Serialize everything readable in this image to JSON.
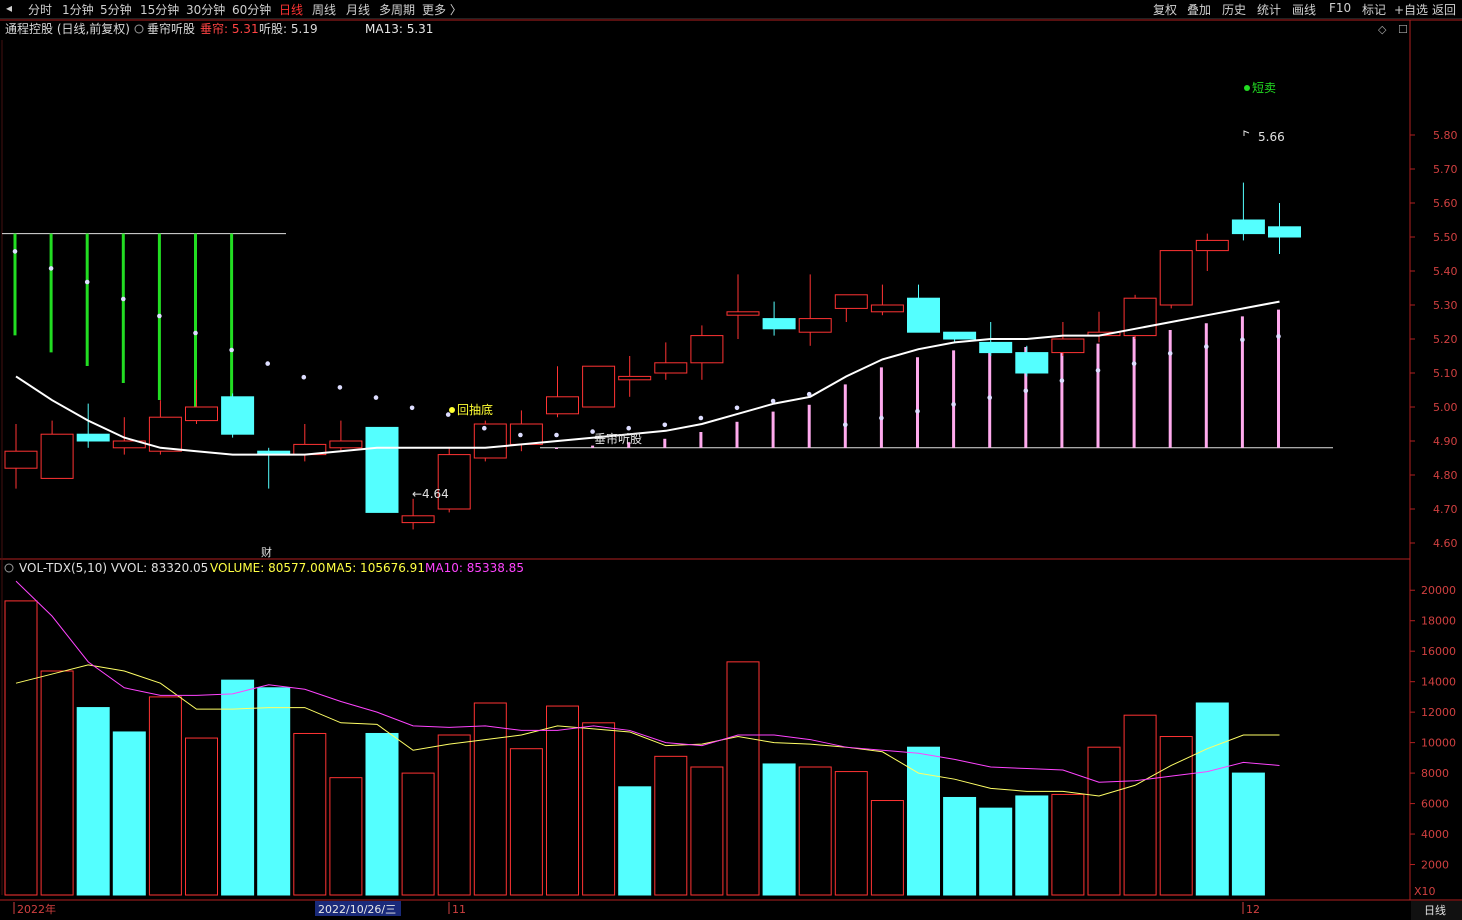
{
  "toolbar": {
    "left_items": [
      "分时",
      "1分钟",
      "5分钟",
      "15分钟",
      "30分钟",
      "60分钟",
      "日线",
      "周线",
      "月线",
      "多周期",
      "更多 〉"
    ],
    "active_index": 6,
    "right_items": [
      "复权",
      "叠加",
      "历史",
      "统计",
      "画线",
      "F10",
      "标记",
      "+自选",
      "返回"
    ]
  },
  "price_header": {
    "stock": "通程控股 (日线,前复权)",
    "indicator": "垂帘听股",
    "indicator_label": "垂帘:",
    "indicator_value": "5.31",
    "listen_label": "听股:",
    "listen_value": "5.19",
    "ma_label": "MA13:",
    "ma_value": "5.31"
  },
  "vol_header": {
    "name": "VOL-TDX(5,10)",
    "vvol_label": "VVOL:",
    "vvol_value": "83320.05",
    "volume_label": "VOLUME:",
    "volume_value": "80577.00",
    "ma5_label": "MA5:",
    "ma5_value": "105676.91",
    "ma10_label": "MA10:",
    "ma10_value": "85338.85"
  },
  "annotations": {
    "low_label": "←4.64",
    "high_label": "5.66",
    "short_sell": "短卖",
    "buy_label": "回抽底",
    "indicator_text": "垂帘听股",
    "finance_marker": "财",
    "vol_scale": "X10"
  },
  "xaxis": {
    "year_label": "2022年",
    "cursor_date": "2022/10/26/三",
    "month_nov": "11",
    "month_dec": "12",
    "period": "日线"
  },
  "colors": {
    "up": "#ff3333",
    "down": "#54ffff",
    "ma_price": "#ffffff",
    "ma5_vol": "#ffff66",
    "ma10_vol": "#ff44ff",
    "axis": "#b02020",
    "green_bar": "#22dd22",
    "pink_bar": "#ffaaee"
  },
  "chart_data": [
    {
      "type": "candlestick",
      "ylim": [
        4.5,
        5.88
      ],
      "yticks": [
        4.6,
        4.7,
        4.8,
        4.9,
        5.0,
        5.1,
        5.2,
        5.3,
        5.4,
        5.5,
        5.6,
        5.7,
        5.8
      ],
      "candles": [
        {
          "o": 4.82,
          "c": 4.87,
          "h": 4.95,
          "l": 4.76
        },
        {
          "o": 4.79,
          "c": 4.92,
          "h": 4.96,
          "l": 4.79
        },
        {
          "o": 4.92,
          "c": 4.9,
          "h": 5.01,
          "l": 4.88
        },
        {
          "o": 4.88,
          "c": 4.9,
          "h": 4.97,
          "l": 4.86
        },
        {
          "o": 4.87,
          "c": 4.97,
          "h": 5.02,
          "l": 4.86
        },
        {
          "o": 4.96,
          "c": 5.0,
          "h": 5.08,
          "l": 4.95
        },
        {
          "o": 5.03,
          "c": 4.92,
          "h": 5.04,
          "l": 4.91
        },
        {
          "o": 4.87,
          "c": 4.86,
          "h": 4.88,
          "l": 4.76
        },
        {
          "o": 4.86,
          "c": 4.89,
          "h": 4.95,
          "l": 4.84
        },
        {
          "o": 4.88,
          "c": 4.9,
          "h": 4.96,
          "l": 4.87
        },
        {
          "o": 4.94,
          "c": 4.69,
          "h": 4.94,
          "l": 4.69
        },
        {
          "o": 4.66,
          "c": 4.68,
          "h": 4.73,
          "l": 4.64
        },
        {
          "o": 4.7,
          "c": 4.86,
          "h": 4.88,
          "l": 4.69
        },
        {
          "o": 4.85,
          "c": 4.95,
          "h": 4.96,
          "l": 4.84
        },
        {
          "o": 4.89,
          "c": 4.95,
          "h": 4.99,
          "l": 4.87
        },
        {
          "o": 4.98,
          "c": 5.03,
          "h": 5.12,
          "l": 4.97
        },
        {
          "o": 5.0,
          "c": 5.12,
          "h": 5.12,
          "l": 5.0
        },
        {
          "o": 5.08,
          "c": 5.09,
          "h": 5.15,
          "l": 5.03
        },
        {
          "o": 5.1,
          "c": 5.13,
          "h": 5.19,
          "l": 5.08
        },
        {
          "o": 5.13,
          "c": 5.21,
          "h": 5.24,
          "l": 5.08
        },
        {
          "o": 5.27,
          "c": 5.28,
          "h": 5.39,
          "l": 5.2
        },
        {
          "o": 5.26,
          "c": 5.23,
          "h": 5.31,
          "l": 5.21
        },
        {
          "o": 5.22,
          "c": 5.26,
          "h": 5.39,
          "l": 5.18
        },
        {
          "o": 5.29,
          "c": 5.33,
          "h": 5.33,
          "l": 5.25
        },
        {
          "o": 5.28,
          "c": 5.3,
          "h": 5.36,
          "l": 5.27
        },
        {
          "o": 5.32,
          "c": 5.22,
          "h": 5.36,
          "l": 5.22
        },
        {
          "o": 5.22,
          "c": 5.2,
          "h": 5.22,
          "l": 5.19
        },
        {
          "o": 5.19,
          "c": 5.16,
          "h": 5.25,
          "l": 5.15
        },
        {
          "o": 5.16,
          "c": 5.1,
          "h": 5.18,
          "l": 5.09
        },
        {
          "o": 5.16,
          "c": 5.2,
          "h": 5.25,
          "l": 5.15
        },
        {
          "o": 5.21,
          "c": 5.22,
          "h": 5.28,
          "l": 5.19
        },
        {
          "o": 5.21,
          "c": 5.32,
          "h": 5.33,
          "l": 5.2
        },
        {
          "o": 5.3,
          "c": 5.46,
          "h": 5.46,
          "l": 5.29
        },
        {
          "o": 5.46,
          "c": 5.49,
          "h": 5.51,
          "l": 5.4
        },
        {
          "o": 5.55,
          "c": 5.51,
          "h": 5.66,
          "l": 5.49
        },
        {
          "o": 5.53,
          "c": 5.5,
          "h": 5.6,
          "l": 5.45
        }
      ],
      "ma13": [
        5.09,
        5.02,
        4.96,
        4.91,
        4.88,
        4.87,
        4.86,
        4.86,
        4.86,
        4.87,
        4.88,
        4.88,
        4.88,
        4.88,
        4.89,
        4.9,
        4.91,
        4.92,
        4.93,
        4.95,
        4.98,
        5.01,
        5.03,
        5.09,
        5.14,
        5.17,
        5.19,
        5.2,
        5.2,
        5.21,
        5.21,
        5.23,
        5.25,
        5.27,
        5.29,
        5.31
      ],
      "upper_signal": [
        5.44,
        5.39,
        5.35,
        5.3,
        5.25,
        5.2,
        5.15,
        5.11,
        5.07,
        5.04,
        5.01,
        4.98,
        4.96,
        4.92,
        4.9,
        4.9,
        4.91,
        4.92,
        4.93,
        4.95,
        4.98,
        5.0,
        5.02,
        4.93,
        4.95,
        4.97,
        4.99,
        5.01,
        5.03,
        5.06,
        5.09,
        5.11,
        5.14,
        5.16,
        5.18,
        5.19
      ],
      "green_bars": [
        0,
        1,
        2,
        3,
        4,
        5,
        6
      ],
      "green_bar_top": 5.51,
      "pink_bar_start": 15,
      "pink_bar_base": 4.88
    },
    {
      "type": "bar",
      "ylim": [
        0,
        21000
      ],
      "yticks": [
        2000,
        4000,
        6000,
        8000,
        10000,
        12000,
        14000,
        16000,
        18000,
        20000
      ],
      "volumes": [
        19300,
        14700,
        12300,
        10700,
        13000,
        10300,
        14100,
        13600,
        10600,
        7700,
        10600,
        8000,
        10500,
        12600,
        9600,
        12400,
        11300,
        7100,
        9100,
        8400,
        15300,
        8600,
        8400,
        8100,
        6200,
        9700,
        6400,
        5700,
        6500,
        6600,
        9700,
        11800,
        10400,
        12600,
        8000
      ],
      "ma5": [
        13900,
        14500,
        15100,
        14700,
        13900,
        12200,
        12200,
        12300,
        12300,
        11300,
        11200,
        9500,
        9900,
        10200,
        10500,
        11100,
        10900,
        10700,
        9800,
        9900,
        10400,
        10000,
        9900,
        9700,
        9400,
        8000,
        7600,
        7000,
        6800,
        6800,
        6500,
        7200,
        8500,
        9600,
        10500,
        10500
      ],
      "ma10": [
        20600,
        18300,
        15300,
        13600,
        13100,
        13100,
        13200,
        13800,
        13500,
        12700,
        12000,
        11100,
        11000,
        11100,
        10800,
        10800,
        11100,
        10800,
        10000,
        9800,
        10500,
        10500,
        10200,
        9700,
        9500,
        9300,
        8900,
        8400,
        8300,
        8200,
        7400,
        7500,
        7800,
        8100,
        8700,
        8500
      ],
      "up": [
        true,
        true,
        false,
        false,
        true,
        true,
        false,
        false,
        true,
        true,
        false,
        true,
        true,
        true,
        true,
        true,
        true,
        false,
        true,
        true,
        true,
        false,
        true,
        true,
        true,
        false,
        false,
        false,
        false,
        true,
        true,
        true,
        true,
        false,
        false
      ]
    }
  ]
}
